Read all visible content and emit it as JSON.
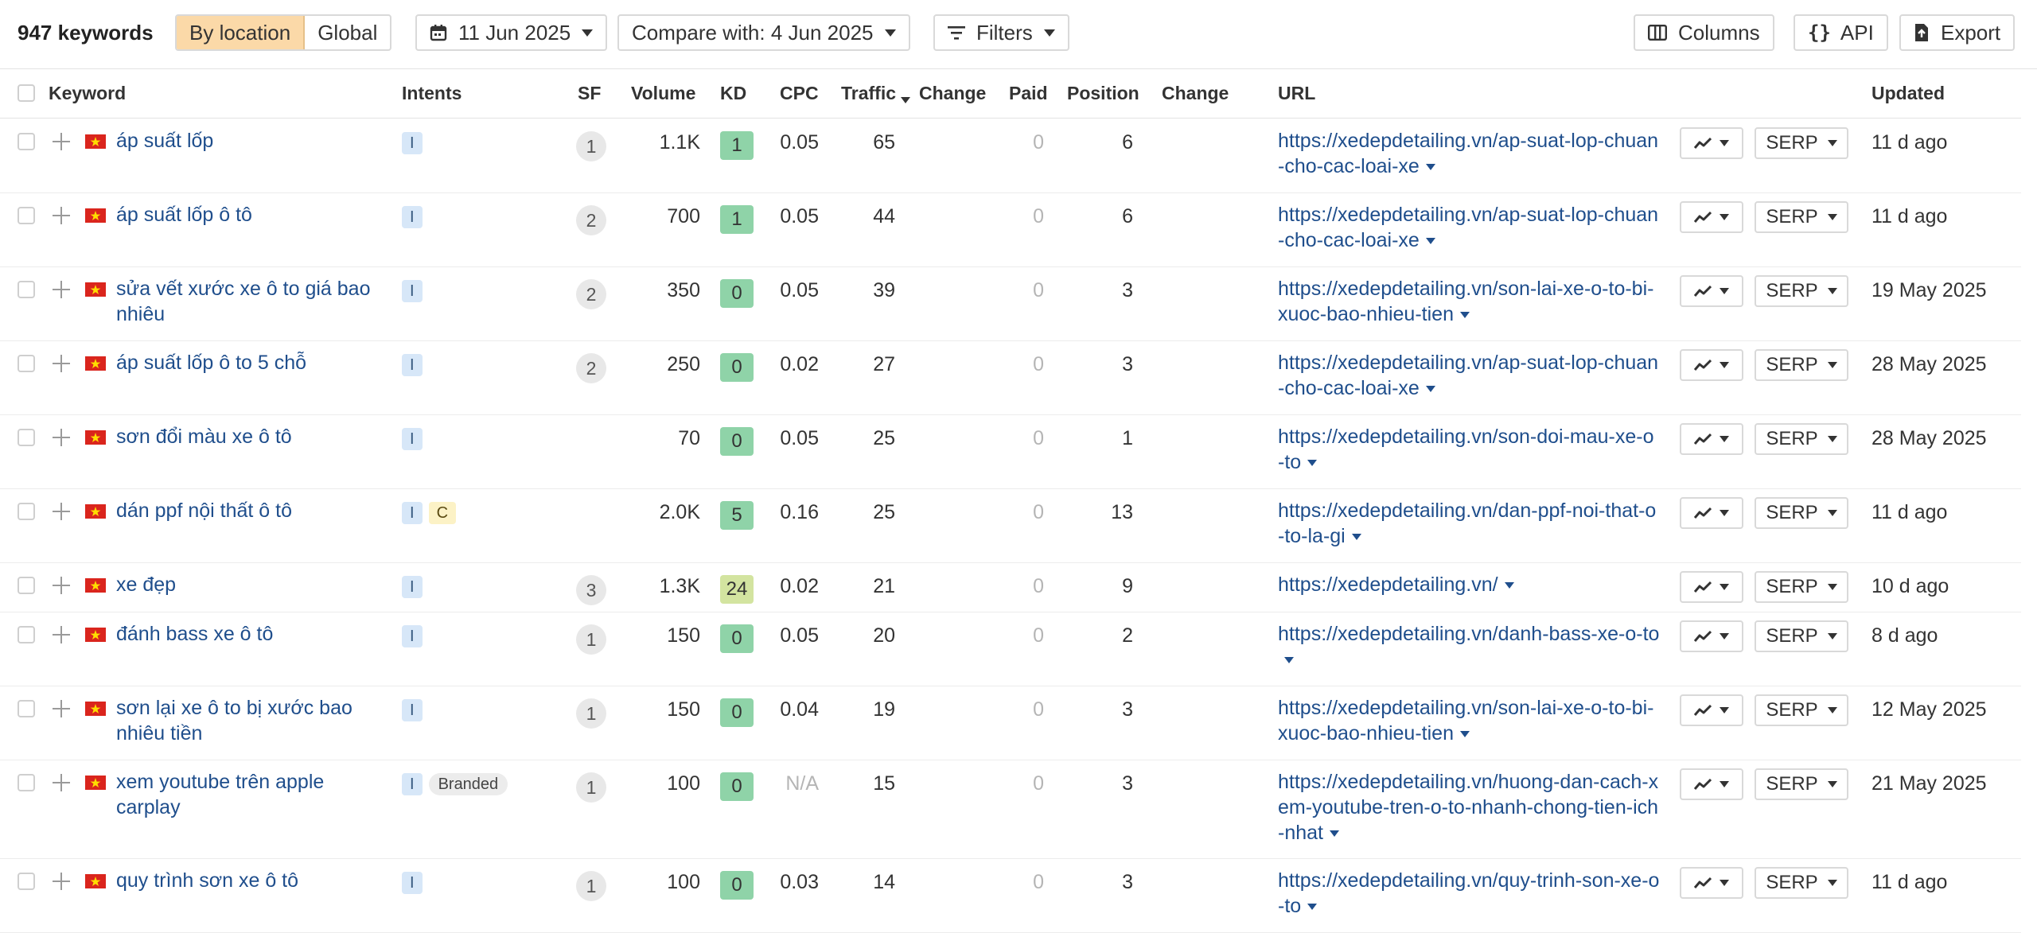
{
  "toolbar": {
    "keyword_count": "947 keywords",
    "by_location": "By location",
    "global": "Global",
    "date": "11 Jun 2025",
    "compare": "Compare with: 4 Jun 2025",
    "filters": "Filters",
    "columns": "Columns",
    "api": "API",
    "export": "Export"
  },
  "columns": {
    "keyword": "Keyword",
    "intents": "Intents",
    "sf": "SF",
    "volume": "Volume",
    "kd": "KD",
    "cpc": "CPC",
    "traffic": "Traffic",
    "change": "Change",
    "paid": "Paid",
    "position": "Position",
    "position_change": "Change",
    "url": "URL",
    "updated": "Updated"
  },
  "colors": {
    "kd_low": "#8fd3a8",
    "kd_medium": "#d3e4a0",
    "selected_segment": "#fbd9a8",
    "link": "#1f4e8c"
  },
  "rows": [
    {
      "keyword": "áp suất lốp",
      "intents": [
        "I"
      ],
      "sf": "1",
      "volume": "1.1K",
      "kd": "1",
      "cpc": "0.05",
      "traffic": "65",
      "paid": "0",
      "position": "6",
      "url": "https://xedepdetailing.vn/ap-suat-lop-chuan-cho-cac-loai-xe",
      "serp": "SERP",
      "updated": "11 d ago"
    },
    {
      "keyword": "áp suất lốp ô tô",
      "intents": [
        "I"
      ],
      "sf": "2",
      "volume": "700",
      "kd": "1",
      "cpc": "0.05",
      "traffic": "44",
      "paid": "0",
      "position": "6",
      "url": "https://xedepdetailing.vn/ap-suat-lop-chuan-cho-cac-loai-xe",
      "serp": "SERP",
      "updated": "11 d ago"
    },
    {
      "keyword": "sửa vết xước xe ô to giá bao nhiêu",
      "intents": [
        "I"
      ],
      "sf": "2",
      "volume": "350",
      "kd": "0",
      "cpc": "0.05",
      "traffic": "39",
      "paid": "0",
      "position": "3",
      "url": "https://xedepdetailing.vn/son-lai-xe-o-to-bi-xuoc-bao-nhieu-tien",
      "serp": "SERP",
      "updated": "19 May 2025"
    },
    {
      "keyword": "áp suất lốp ô to 5 chỗ",
      "intents": [
        "I"
      ],
      "sf": "2",
      "volume": "250",
      "kd": "0",
      "cpc": "0.02",
      "traffic": "27",
      "paid": "0",
      "position": "3",
      "url": "https://xedepdetailing.vn/ap-suat-lop-chuan-cho-cac-loai-xe",
      "serp": "SERP",
      "updated": "28 May 2025"
    },
    {
      "keyword": "sơn đổi màu xe ô tô",
      "intents": [
        "I"
      ],
      "sf": "",
      "volume": "70",
      "kd": "0",
      "cpc": "0.05",
      "traffic": "25",
      "paid": "0",
      "position": "1",
      "url": "https://xedepdetailing.vn/son-doi-mau-xe-o-to",
      "serp": "SERP",
      "updated": "28 May 2025"
    },
    {
      "keyword": "dán ppf nội thất ô tô",
      "intents": [
        "I",
        "C"
      ],
      "sf": "",
      "volume": "2.0K",
      "kd": "5",
      "cpc": "0.16",
      "traffic": "25",
      "paid": "0",
      "position": "13",
      "url": "https://xedepdetailing.vn/dan-ppf-noi-that-o-to-la-gi",
      "serp": "SERP",
      "updated": "11 d ago"
    },
    {
      "keyword": "xe đẹp",
      "intents": [
        "I"
      ],
      "sf": "3",
      "volume": "1.3K",
      "kd": "24",
      "cpc": "0.02",
      "traffic": "21",
      "paid": "0",
      "position": "9",
      "url": "https://xedepdetailing.vn/",
      "serp": "SERP",
      "updated": "10 d ago"
    },
    {
      "keyword": "đánh bass xe ô tô",
      "intents": [
        "I"
      ],
      "sf": "1",
      "volume": "150",
      "kd": "0",
      "cpc": "0.05",
      "traffic": "20",
      "paid": "0",
      "position": "2",
      "url": "https://xedepdetailing.vn/danh-bass-xe-o-to",
      "serp": "SERP",
      "updated": "8 d ago"
    },
    {
      "keyword": "sơn lại xe ô to bị xước bao nhiêu tiền",
      "intents": [
        "I"
      ],
      "sf": "1",
      "volume": "150",
      "kd": "0",
      "cpc": "0.04",
      "traffic": "19",
      "paid": "0",
      "position": "3",
      "url": "https://xedepdetailing.vn/son-lai-xe-o-to-bi-xuoc-bao-nhieu-tien",
      "serp": "SERP",
      "updated": "12 May 2025"
    },
    {
      "keyword": "xem youtube trên apple carplay",
      "intents": [
        "I",
        "Branded"
      ],
      "sf": "1",
      "volume": "100",
      "kd": "0",
      "cpc": "N/A",
      "traffic": "15",
      "paid": "0",
      "position": "3",
      "url": "https://xedepdetailing.vn/huong-dan-cach-xem-youtube-tren-o-to-nhanh-chong-tien-ich-nhat",
      "serp": "SERP",
      "updated": "21 May 2025"
    },
    {
      "keyword": "quy trình sơn xe ô tô",
      "intents": [
        "I"
      ],
      "sf": "1",
      "volume": "100",
      "kd": "0",
      "cpc": "0.03",
      "traffic": "14",
      "paid": "0",
      "position": "3",
      "url": "https://xedepdetailing.vn/quy-trinh-son-xe-o-to",
      "serp": "SERP",
      "updated": "11 d ago"
    }
  ]
}
